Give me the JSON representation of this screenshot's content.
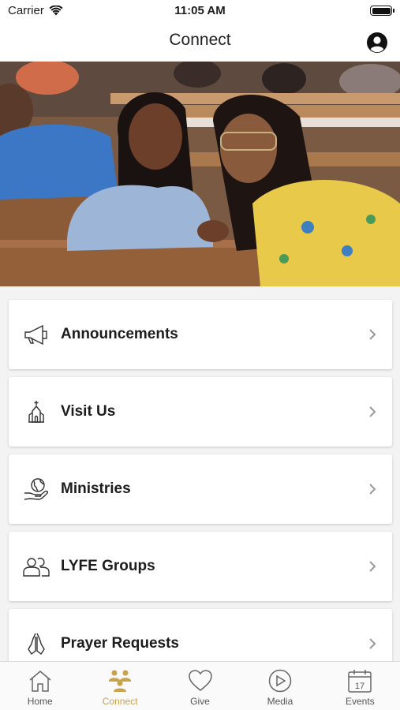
{
  "status_bar": {
    "carrier": "Carrier",
    "time": "11:05 AM"
  },
  "nav": {
    "title": "Connect",
    "profile_icon": "person-circle-icon"
  },
  "hero": {
    "description_alt": ""
  },
  "menu": [
    {
      "label": "Announcements",
      "icon": "megaphone-icon"
    },
    {
      "label": "Visit Us",
      "icon": "church-icon"
    },
    {
      "label": "Ministries",
      "icon": "globe-hand-icon"
    },
    {
      "label": "LYFE Groups",
      "icon": "people-icon"
    },
    {
      "label": "Prayer Requests",
      "icon": "praying-hands-icon"
    }
  ],
  "tabs": [
    {
      "label": "Home",
      "icon": "home-icon",
      "active": false
    },
    {
      "label": "Connect",
      "icon": "group-icon",
      "active": true
    },
    {
      "label": "Give",
      "icon": "heart-icon",
      "active": false
    },
    {
      "label": "Media",
      "icon": "play-circle-icon",
      "active": false
    },
    {
      "label": "Events",
      "icon": "calendar-icon",
      "active": false
    }
  ],
  "colors": {
    "accent": "#c9a24c",
    "tab_inactive": "#555555",
    "list_background": "#f3f3f3"
  },
  "calendar_day": "17"
}
